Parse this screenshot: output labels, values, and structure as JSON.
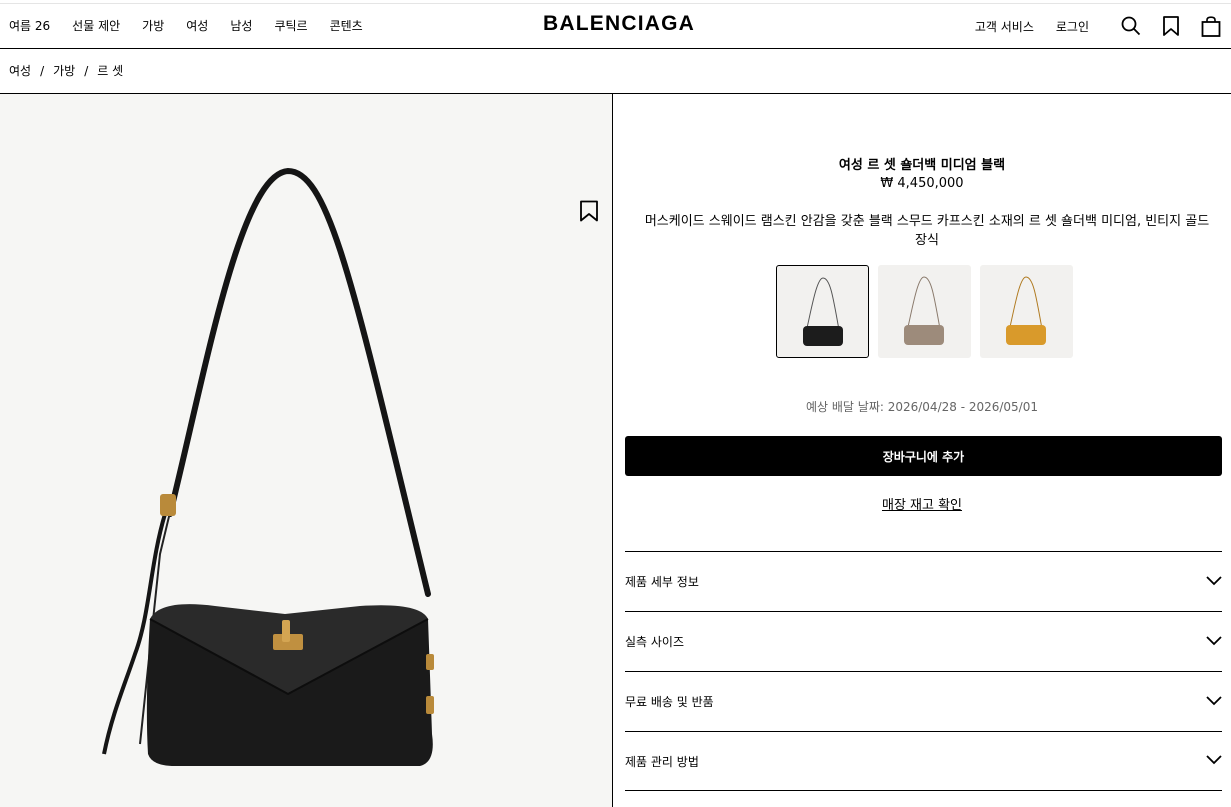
{
  "header": {
    "brand": "BALENCIAGA",
    "nav": [
      "여름 26",
      "선물 제안",
      "가방",
      "여성",
      "남성",
      "쿠틱르",
      "콘텐츠"
    ],
    "customer_service": "고객 서비스",
    "login": "로그인"
  },
  "breadcrumb": [
    "여성",
    "가방",
    "르 셋"
  ],
  "product": {
    "title": "여성 르 셋 숄더백 미디엄 블랙",
    "price": "₩ 4,450,000",
    "description": "머스케이드 스웨이드 램스킨 안감을 갖춘 블랙 스무드 카프스킨 소재의 르 셋 숄더백 미디엄, 빈티지 골드 장식",
    "variants": [
      {
        "color": "#1c1c1c"
      },
      {
        "color": "#9d8b7b"
      },
      {
        "color": "#d99a2b"
      }
    ],
    "delivery": "예상 배달 날짜: 2026/04/28 - 2026/05/01",
    "add_to_cart": "장바구니에 추가",
    "store_stock": "매장 재고 확인"
  },
  "accordion": [
    "제품 세부 정보",
    "실측 사이즈",
    "무료 배송 및 반품",
    "제품 관리 방법"
  ],
  "icons": [
    "search-icon",
    "bookmark-icon",
    "bag-icon",
    "chevron-down-icon"
  ]
}
